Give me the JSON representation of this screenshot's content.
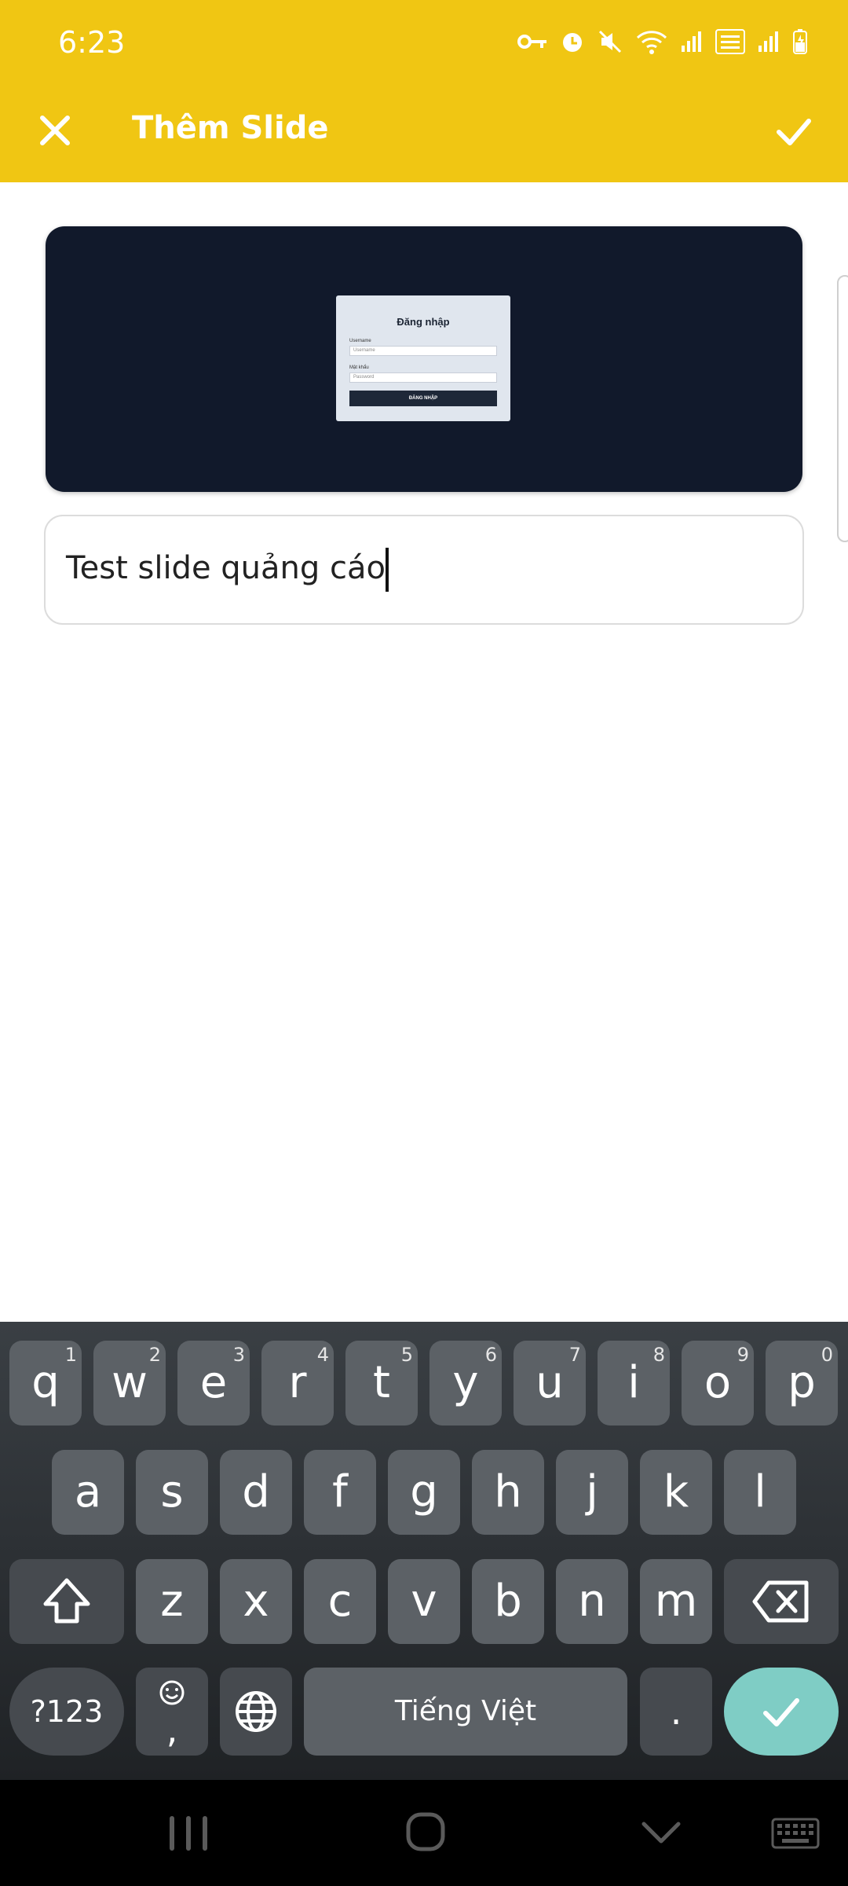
{
  "status": {
    "time": "6:23"
  },
  "appbar": {
    "title": "Thêm Slide",
    "close_icon": "close-icon",
    "confirm_icon": "check-icon"
  },
  "preview": {
    "login_title": "Đăng nhập",
    "username_label": "Username",
    "username_placeholder": "Username",
    "password_label": "Mật khẩu",
    "password_placeholder": "Password",
    "login_button": "ĐĂNG NHẬP"
  },
  "caption": {
    "value": "Test slide quảng cáo"
  },
  "keyboard": {
    "row1": [
      {
        "ch": "q",
        "hint": "1"
      },
      {
        "ch": "w",
        "hint": "2"
      },
      {
        "ch": "e",
        "hint": "3"
      },
      {
        "ch": "r",
        "hint": "4"
      },
      {
        "ch": "t",
        "hint": "5"
      },
      {
        "ch": "y",
        "hint": "6"
      },
      {
        "ch": "u",
        "hint": "7"
      },
      {
        "ch": "i",
        "hint": "8"
      },
      {
        "ch": "o",
        "hint": "9"
      },
      {
        "ch": "p",
        "hint": "0"
      }
    ],
    "row2": [
      "a",
      "s",
      "d",
      "f",
      "g",
      "h",
      "j",
      "k",
      "l"
    ],
    "row3": [
      "z",
      "x",
      "c",
      "v",
      "b",
      "n",
      "m"
    ],
    "sym_label": "?123",
    "comma_label": ",",
    "space_label": "Tiếng Việt",
    "period_label": "."
  },
  "colors": {
    "accent": "#f0c613",
    "done_key": "#7fcdc5"
  }
}
